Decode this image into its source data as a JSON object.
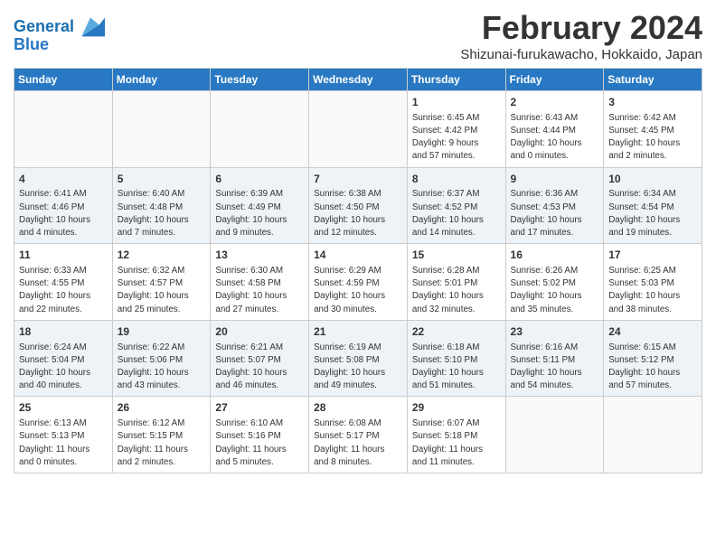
{
  "header": {
    "logo_line1": "General",
    "logo_line2": "Blue",
    "month": "February 2024",
    "location": "Shizunai-furukawacho, Hokkaido, Japan"
  },
  "days_of_week": [
    "Sunday",
    "Monday",
    "Tuesday",
    "Wednesday",
    "Thursday",
    "Friday",
    "Saturday"
  ],
  "weeks": [
    [
      {
        "day": "",
        "info": ""
      },
      {
        "day": "",
        "info": ""
      },
      {
        "day": "",
        "info": ""
      },
      {
        "day": "",
        "info": ""
      },
      {
        "day": "1",
        "info": "Sunrise: 6:45 AM\nSunset: 4:42 PM\nDaylight: 9 hours\nand 57 minutes."
      },
      {
        "day": "2",
        "info": "Sunrise: 6:43 AM\nSunset: 4:44 PM\nDaylight: 10 hours\nand 0 minutes."
      },
      {
        "day": "3",
        "info": "Sunrise: 6:42 AM\nSunset: 4:45 PM\nDaylight: 10 hours\nand 2 minutes."
      }
    ],
    [
      {
        "day": "4",
        "info": "Sunrise: 6:41 AM\nSunset: 4:46 PM\nDaylight: 10 hours\nand 4 minutes."
      },
      {
        "day": "5",
        "info": "Sunrise: 6:40 AM\nSunset: 4:48 PM\nDaylight: 10 hours\nand 7 minutes."
      },
      {
        "day": "6",
        "info": "Sunrise: 6:39 AM\nSunset: 4:49 PM\nDaylight: 10 hours\nand 9 minutes."
      },
      {
        "day": "7",
        "info": "Sunrise: 6:38 AM\nSunset: 4:50 PM\nDaylight: 10 hours\nand 12 minutes."
      },
      {
        "day": "8",
        "info": "Sunrise: 6:37 AM\nSunset: 4:52 PM\nDaylight: 10 hours\nand 14 minutes."
      },
      {
        "day": "9",
        "info": "Sunrise: 6:36 AM\nSunset: 4:53 PM\nDaylight: 10 hours\nand 17 minutes."
      },
      {
        "day": "10",
        "info": "Sunrise: 6:34 AM\nSunset: 4:54 PM\nDaylight: 10 hours\nand 19 minutes."
      }
    ],
    [
      {
        "day": "11",
        "info": "Sunrise: 6:33 AM\nSunset: 4:55 PM\nDaylight: 10 hours\nand 22 minutes."
      },
      {
        "day": "12",
        "info": "Sunrise: 6:32 AM\nSunset: 4:57 PM\nDaylight: 10 hours\nand 25 minutes."
      },
      {
        "day": "13",
        "info": "Sunrise: 6:30 AM\nSunset: 4:58 PM\nDaylight: 10 hours\nand 27 minutes."
      },
      {
        "day": "14",
        "info": "Sunrise: 6:29 AM\nSunset: 4:59 PM\nDaylight: 10 hours\nand 30 minutes."
      },
      {
        "day": "15",
        "info": "Sunrise: 6:28 AM\nSunset: 5:01 PM\nDaylight: 10 hours\nand 32 minutes."
      },
      {
        "day": "16",
        "info": "Sunrise: 6:26 AM\nSunset: 5:02 PM\nDaylight: 10 hours\nand 35 minutes."
      },
      {
        "day": "17",
        "info": "Sunrise: 6:25 AM\nSunset: 5:03 PM\nDaylight: 10 hours\nand 38 minutes."
      }
    ],
    [
      {
        "day": "18",
        "info": "Sunrise: 6:24 AM\nSunset: 5:04 PM\nDaylight: 10 hours\nand 40 minutes."
      },
      {
        "day": "19",
        "info": "Sunrise: 6:22 AM\nSunset: 5:06 PM\nDaylight: 10 hours\nand 43 minutes."
      },
      {
        "day": "20",
        "info": "Sunrise: 6:21 AM\nSunset: 5:07 PM\nDaylight: 10 hours\nand 46 minutes."
      },
      {
        "day": "21",
        "info": "Sunrise: 6:19 AM\nSunset: 5:08 PM\nDaylight: 10 hours\nand 49 minutes."
      },
      {
        "day": "22",
        "info": "Sunrise: 6:18 AM\nSunset: 5:10 PM\nDaylight: 10 hours\nand 51 minutes."
      },
      {
        "day": "23",
        "info": "Sunrise: 6:16 AM\nSunset: 5:11 PM\nDaylight: 10 hours\nand 54 minutes."
      },
      {
        "day": "24",
        "info": "Sunrise: 6:15 AM\nSunset: 5:12 PM\nDaylight: 10 hours\nand 57 minutes."
      }
    ],
    [
      {
        "day": "25",
        "info": "Sunrise: 6:13 AM\nSunset: 5:13 PM\nDaylight: 11 hours\nand 0 minutes."
      },
      {
        "day": "26",
        "info": "Sunrise: 6:12 AM\nSunset: 5:15 PM\nDaylight: 11 hours\nand 2 minutes."
      },
      {
        "day": "27",
        "info": "Sunrise: 6:10 AM\nSunset: 5:16 PM\nDaylight: 11 hours\nand 5 minutes."
      },
      {
        "day": "28",
        "info": "Sunrise: 6:08 AM\nSunset: 5:17 PM\nDaylight: 11 hours\nand 8 minutes."
      },
      {
        "day": "29",
        "info": "Sunrise: 6:07 AM\nSunset: 5:18 PM\nDaylight: 11 hours\nand 11 minutes."
      },
      {
        "day": "",
        "info": ""
      },
      {
        "day": "",
        "info": ""
      }
    ]
  ]
}
